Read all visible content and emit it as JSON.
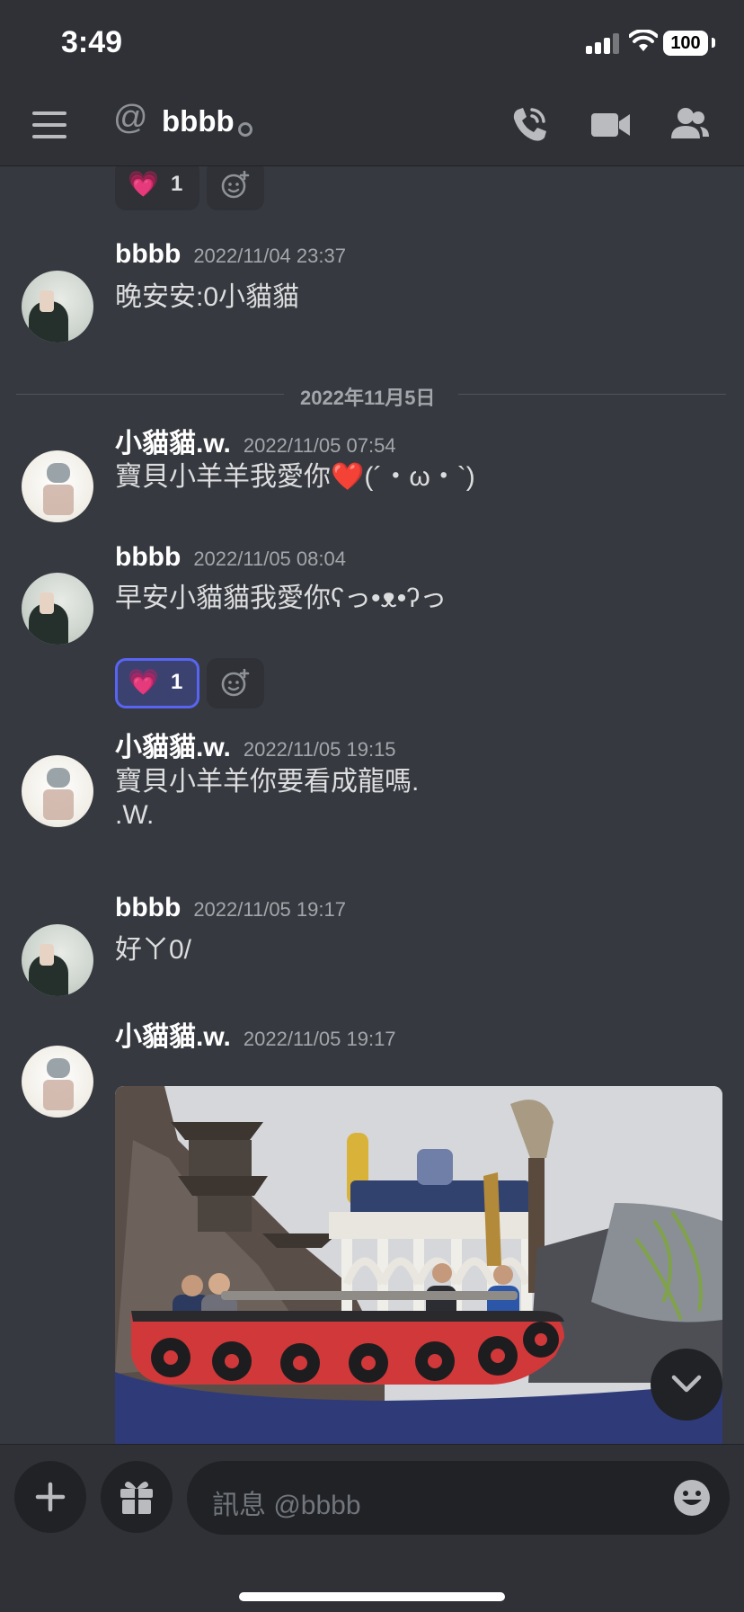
{
  "status_bar": {
    "time": "3:49",
    "battery": "100"
  },
  "header": {
    "at_symbol": "@",
    "channel_name": "bbbb"
  },
  "divider": {
    "date_label": "2022年11月5日"
  },
  "messages": [
    {
      "author": "bbbb",
      "timestamp": "2022/11/04 23:37",
      "lines": [
        "晚安安:0小貓貓"
      ]
    },
    {
      "author": "小貓貓.w.",
      "timestamp": "2022/11/05 07:54",
      "lines": [
        "寶貝小羊羊我愛你❤️(´・ω・`)"
      ]
    },
    {
      "author": "bbbb",
      "timestamp": "2022/11/05 08:04",
      "lines": [
        "早安小貓貓我愛你ʕっ•ᴥ•ʔっ"
      ]
    },
    {
      "author": "小貓貓.w.",
      "timestamp": "2022/11/05 19:15",
      "lines": [
        "寶貝小羊羊你要看成龍嗎.",
        ".W."
      ]
    },
    {
      "author": "bbbb",
      "timestamp": "2022/11/05 19:17",
      "lines": [
        "好ㄚ0/"
      ]
    },
    {
      "author": "小貓貓.w.",
      "timestamp": "2022/11/05 19:17",
      "lines": []
    }
  ],
  "reactions": [
    {
      "emoji": "💗",
      "count": "1",
      "active": false
    },
    {
      "emoji": "💗",
      "count": "1",
      "active": true
    }
  ],
  "composer": {
    "placeholder": "訊息 @bbbb"
  },
  "icons": {
    "menu": "hamburger-menu-icon",
    "call": "phone-call-icon",
    "video": "video-camera-icon",
    "members": "members-icon",
    "add_reaction": "add-reaction-icon",
    "plus": "plus-icon",
    "gift": "gift-icon",
    "emoji": "emoji-icon",
    "scroll": "chevron-down-icon"
  },
  "colors": {
    "background": "#36393f",
    "header": "#2f3136",
    "accent": "#5865f2",
    "text": "#dcddde",
    "muted": "#a3a6aa"
  }
}
